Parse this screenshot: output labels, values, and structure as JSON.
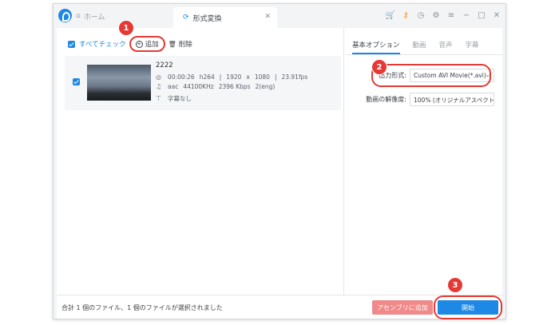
{
  "titlebar": {
    "home_tab": "ホーム",
    "convert_tab": "形式変換",
    "close_symbol": "✕",
    "icons": [
      "cart-icon",
      "key-icon",
      "clock-icon",
      "settings-icon",
      "menu-icon",
      "minimize-icon",
      "maximize-icon",
      "close-icon"
    ]
  },
  "toolbar": {
    "check_all_label": "すべてチェック",
    "add_label": "追加",
    "delete_label": "削除"
  },
  "file": {
    "name": "2222",
    "duration": "00:00:26",
    "codec": "h264",
    "width": "1920",
    "times": "x",
    "height": "1080",
    "fps": "23.91fps",
    "audio_codec": "aac",
    "sample_rate": "44100KHz",
    "bitrate": "2396 Kbps",
    "channels": "2(eng)",
    "subtitle": "字幕なし",
    "sep": "|"
  },
  "options": {
    "tabs": [
      "基本オプション",
      "動画",
      "音声",
      "字幕"
    ],
    "format_label": "出力形式:",
    "format_value": "Custom AVI Movie(*.avi)",
    "resolution_label": "動画の解像度:",
    "resolution_value": "100% (オリジナルアスペクト"
  },
  "status": {
    "summary": "合計 1 個のファイル、1 個のファイルが選択されました",
    "merge_label": "アセンブリに追加",
    "start_label": "開始"
  },
  "badges": [
    "1",
    "2",
    "3"
  ],
  "colors": {
    "accent": "#1e88e5",
    "highlight": "#e53935",
    "merge_button": "#f08a8a"
  }
}
